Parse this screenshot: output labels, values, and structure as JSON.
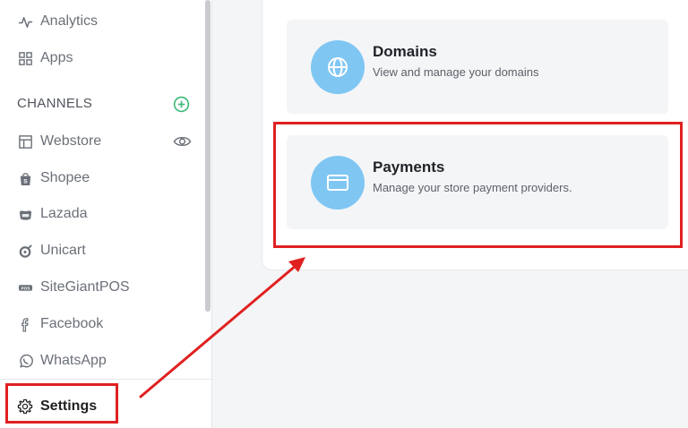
{
  "sidebar": {
    "items_top": [
      {
        "label": "Analytics",
        "icon": "analytics-icon"
      },
      {
        "label": "Apps",
        "icon": "apps-grid-icon"
      }
    ],
    "channels_label": "CHANNELS",
    "channels": [
      {
        "label": "Webstore",
        "icon": "webstore-icon"
      },
      {
        "label": "Shopee",
        "icon": "shopee-bag-icon"
      },
      {
        "label": "Lazada",
        "icon": "lazada-icon"
      },
      {
        "label": "Unicart",
        "icon": "unicart-icon"
      },
      {
        "label": "SiteGiantPOS",
        "icon": "pos-icon"
      },
      {
        "label": "Facebook",
        "icon": "facebook-icon"
      },
      {
        "label": "WhatsApp",
        "icon": "whatsapp-icon"
      }
    ],
    "settings_label": "Settings"
  },
  "cards": {
    "domains": {
      "title": "Domains",
      "description": "View and manage your domains",
      "icon": "globe-icon"
    },
    "payments": {
      "title": "Payments",
      "description": "Manage your store payment providers.",
      "icon": "credit-card-icon"
    }
  },
  "colors": {
    "highlight": "#e02020",
    "icon_circle": "#7fc6f3",
    "add_icon": "#3cb878",
    "sidebar_text": "#6b7078"
  }
}
